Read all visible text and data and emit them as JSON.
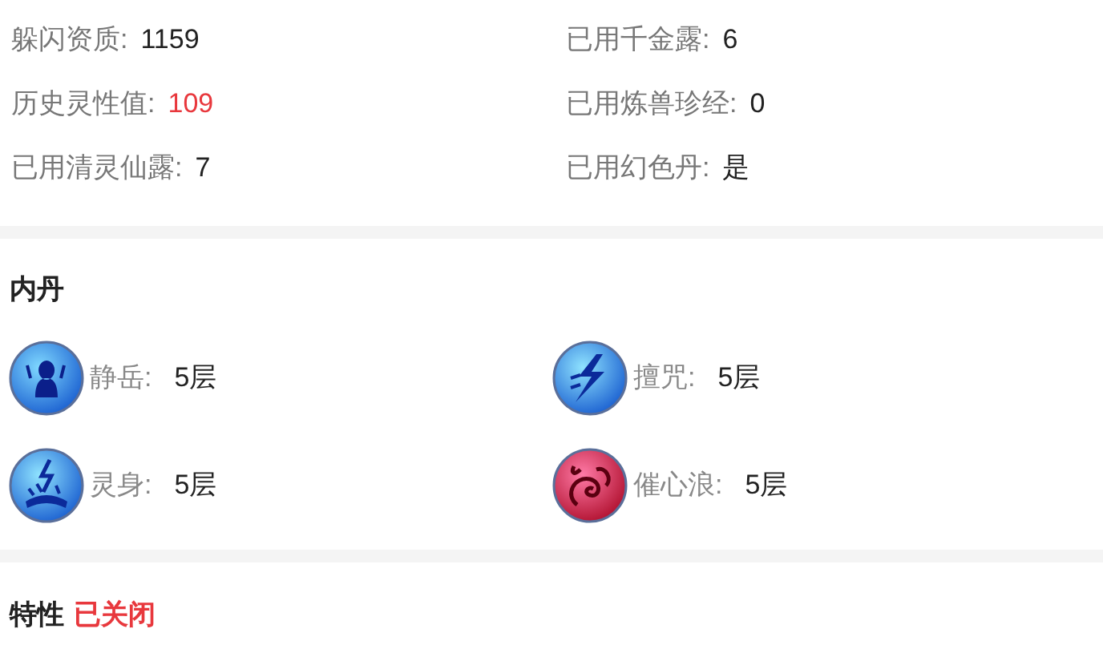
{
  "stats": [
    {
      "label": "躲闪资质:",
      "value": "1159",
      "highlight": false
    },
    {
      "label": "已用千金露:",
      "value": "6",
      "highlight": false
    },
    {
      "label": "历史灵性值:",
      "value": "109",
      "highlight": true
    },
    {
      "label": "已用炼兽珍经:",
      "value": "0",
      "highlight": false
    },
    {
      "label": "已用清灵仙露:",
      "value": "7",
      "highlight": false
    },
    {
      "label": "已用幻色丹:",
      "value": "是",
      "highlight": false
    }
  ],
  "inner_pill": {
    "title": "内丹",
    "items": [
      {
        "kind": "figure",
        "name": "静岳:",
        "level": "5层"
      },
      {
        "kind": "bolt",
        "name": "擅咒:",
        "level": "5层"
      },
      {
        "kind": "spark",
        "name": "灵身:",
        "level": "5层"
      },
      {
        "kind": "swirl",
        "name": "催心浪:",
        "level": "5层"
      }
    ]
  },
  "traits": {
    "title": "特性",
    "status": "已关闭"
  }
}
